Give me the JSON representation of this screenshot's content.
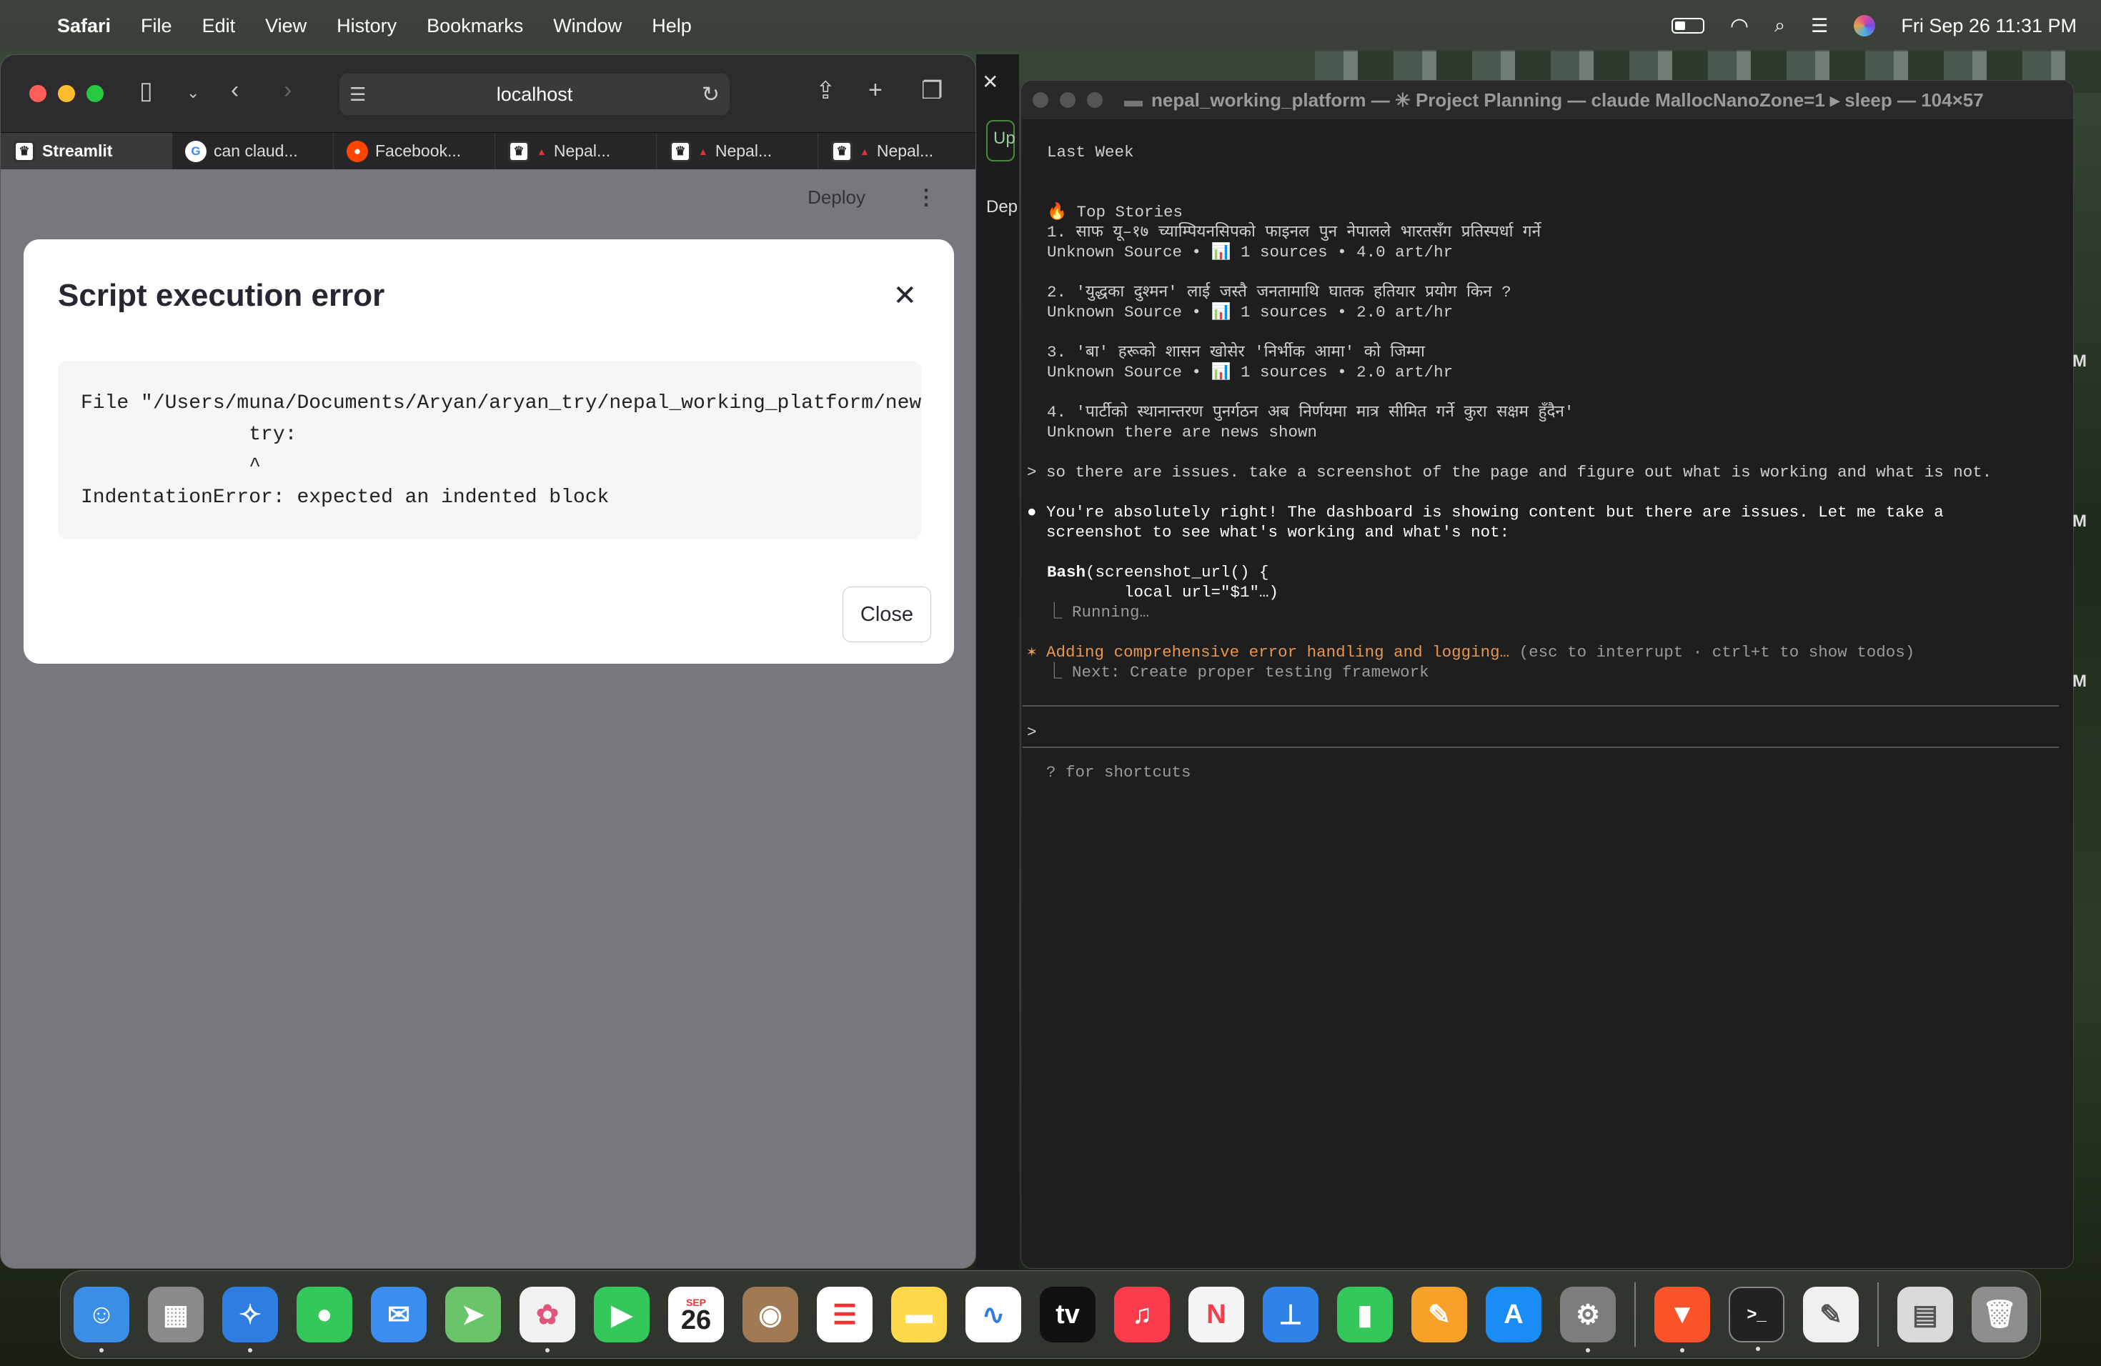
{
  "menubar": {
    "app": "Safari",
    "items": [
      "File",
      "Edit",
      "View",
      "History",
      "Bookmarks",
      "Window",
      "Help"
    ],
    "datetime": "Fri Sep 26  11:31 PM"
  },
  "safari": {
    "url": "localhost",
    "tabs": [
      {
        "label": "Streamlit",
        "icon": "streamlit-icon"
      },
      {
        "label": "can claud...",
        "icon": "google-icon"
      },
      {
        "label": "Facebook...",
        "icon": "reddit-icon"
      },
      {
        "label": "Nepal...",
        "icon": "streamlit-icon"
      },
      {
        "label": "Nepal...",
        "icon": "streamlit-icon"
      },
      {
        "label": "Nepal...",
        "icon": "streamlit-icon"
      }
    ]
  },
  "streamlit": {
    "deploy": "Deploy",
    "modal": {
      "title": "Script execution error",
      "code_lines": [
        "File \"/Users/muna/Documents/Aryan/aryan_try/nepal_working_platform/new",
        "              try:",
        "              ^",
        "IndentationError: expected an indented block"
      ],
      "close": "Close"
    }
  },
  "strip": {
    "up": "Up",
    "dep": "Dep"
  },
  "terminal": {
    "title": "nepal_working_platform — ✳ Project Planning — claude MallocNanoZone=1 ▸ sleep — 104×57",
    "lines": {
      "last_week": "Last Week",
      "top_stories": "🔥 Top Stories",
      "s1": "1. साफ यू–१७ च्याम्पियनसिपको फाइनल पुन नेपालले भारतसँग प्रतिस्पर्धा गर्ने",
      "s1_meta": "Unknown Source • 📊 1 sources • 4.0 art/hr",
      "s2": "2. 'युद्धका दुश्मन' लाई जस्तै जनतामाथि घातक हतियार प्रयोग किन ?",
      "s2_meta": "Unknown Source • 📊 1 sources • 2.0 art/hr",
      "s3": "3. 'बा' हरूको शासन खोसेर 'निर्भीक आमा' को जिम्मा",
      "s3_meta": "Unknown Source • 📊 1 sources • 2.0 art/hr",
      "s4": "4. 'पार्टीको स्थानान्तरण पुनर्गठन अब निर्णयमा मात्र सीमित गर्ने कुरा सक्षम हुँदैन'",
      "s4_meta": "Unknown there are news shown",
      "prompt": "> so there are issues. take a screenshot of the page and figure out what is working and what is not.",
      "reply1": "● You're absolutely right! The dashboard is showing content but there are issues. Let me take a",
      "reply2": "  screenshot to see what's working and what's not:",
      "bash_name": "Bash",
      "bash1": "(screenshot_url() {",
      "bash2": "        local url=\"$1\"…)",
      "running": "  ⎿ Running…",
      "status": "✶ Adding comprehensive error handling and logging…",
      "status_hint": " (esc to interrupt · ctrl+t to show todos)",
      "next": "  ⎿ Next: Create proper testing framework",
      "input_prompt": ">",
      "shortcuts": "  ? for shortcuts"
    }
  },
  "edge_letters": [
    "M",
    "M",
    "M"
  ],
  "dock": {
    "calendar_month": "SEP",
    "calendar_day": "26",
    "tv_label": "tv",
    "colors": {
      "finder": "#3a8ee6",
      "launchpad": "#8a8a8a",
      "safari": "#2f7de0",
      "messages": "#34c759",
      "mail": "#3b8df0",
      "maps": "#6ac46a",
      "photos": "#f2f2f2",
      "facetime": "#34c759",
      "calendar": "#ffffff",
      "contacts": "#a07a55",
      "reminders": "#ffffff",
      "notes": "#ffd94a",
      "freeform": "#ffffff",
      "tv": "#111111",
      "music": "#fa3c4c",
      "news": "#f5f5f5",
      "keynote": "#2f82e8",
      "numbers": "#34c759",
      "pages": "#f7a02a",
      "appstore": "#1a8cf5",
      "settings": "#7d7d7d",
      "brave": "#fb542b",
      "terminal": "#222222",
      "textedit": "#f0f0f0",
      "preview": "#d9d9d9",
      "trash": "#8e8e8e"
    }
  }
}
